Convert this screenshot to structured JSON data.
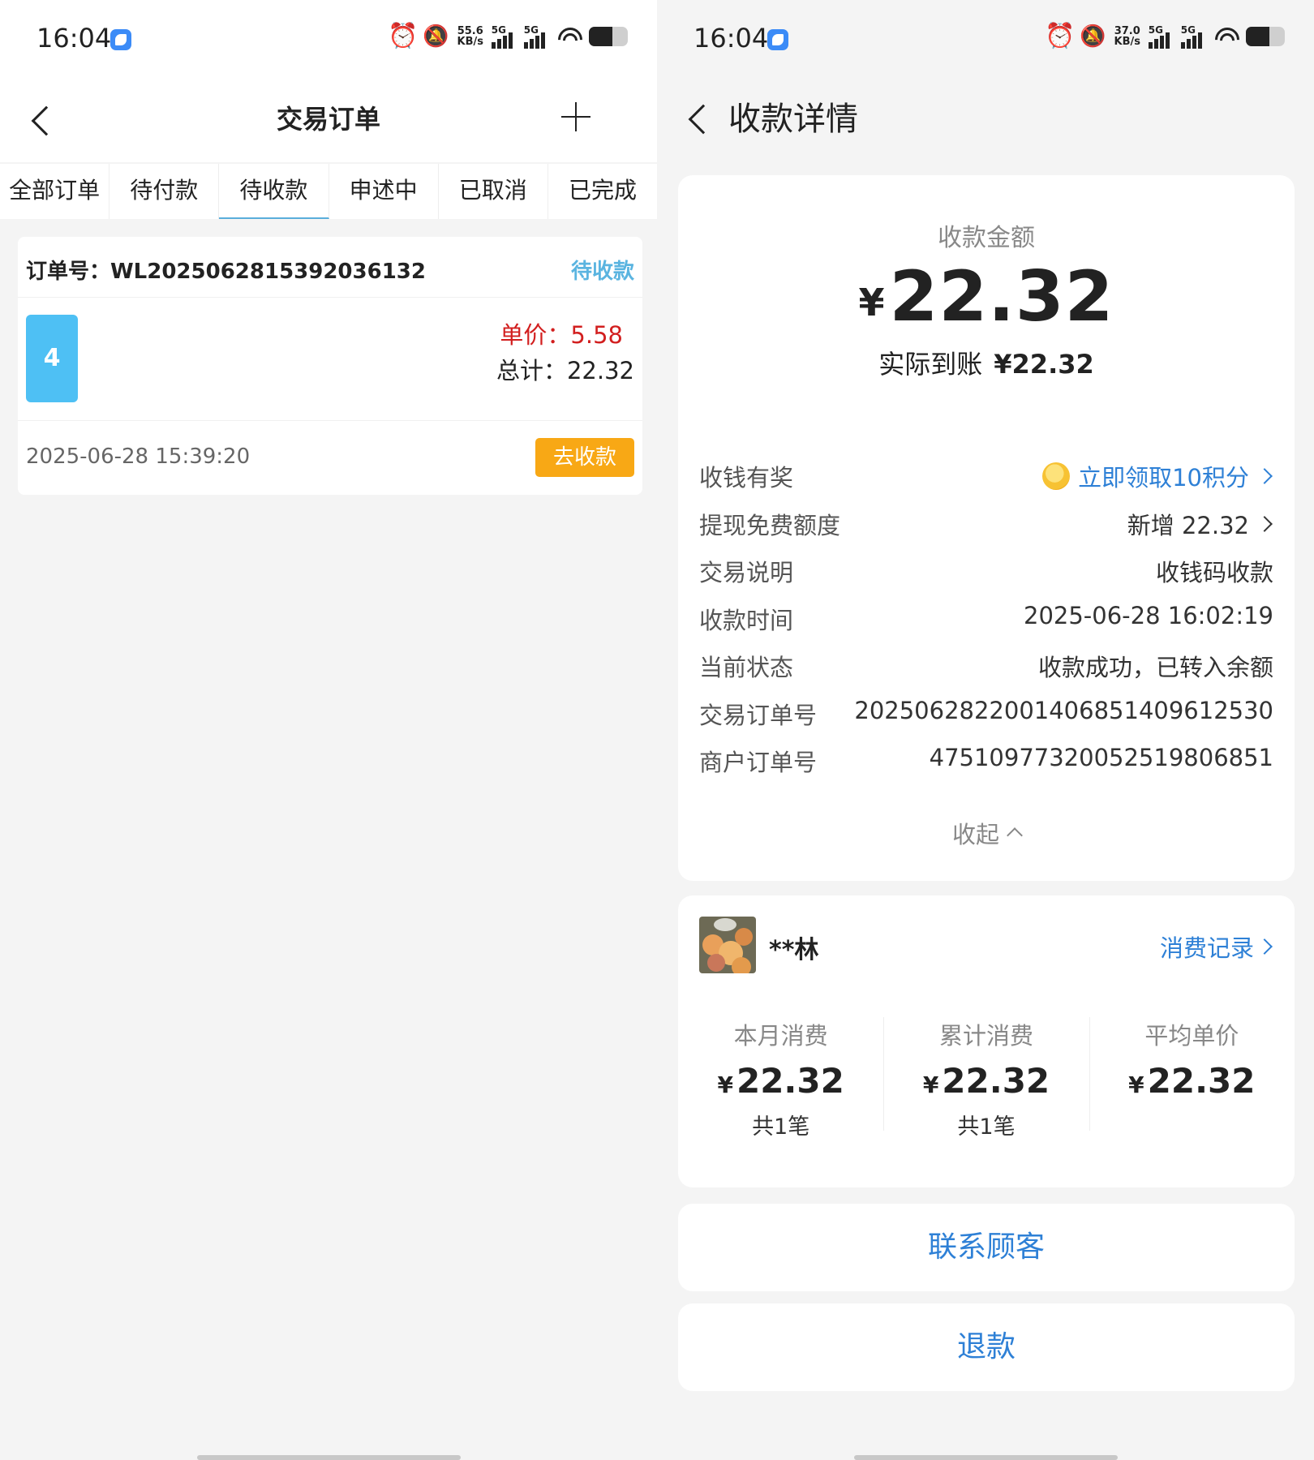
{
  "left": {
    "status_bar": {
      "time": "16:04",
      "net_speed_value": "55.6",
      "net_speed_unit": "KB/s",
      "signal1": "5G",
      "signal2": "5G",
      "battery_level": 0.6
    },
    "header": {
      "title": "交易订单"
    },
    "tabs": [
      {
        "label": "全部订单"
      },
      {
        "label": "待付款"
      },
      {
        "label": "待收款"
      },
      {
        "label": "申述中"
      },
      {
        "label": "已取消"
      },
      {
        "label": "已完成"
      }
    ],
    "active_tab_index": 2,
    "order": {
      "order_no": "订单号：WL2025062815392036132",
      "status": "待收款",
      "quantity": "4",
      "unit_price": "单价：5.58",
      "total": "总计：22.32",
      "time": "2025-06-28 15:39:20",
      "action_label": "去收款"
    }
  },
  "right": {
    "status_bar": {
      "time": "16:04",
      "net_speed_value": "37.0",
      "net_speed_unit": "KB/s",
      "signal1": "5G",
      "signal2": "5G",
      "battery_level": 0.6
    },
    "header": {
      "title": "收款详情"
    },
    "amount": {
      "label": "收款金额",
      "currency": "¥",
      "value": "22.32",
      "actual_label": "实际到账",
      "actual_value": "¥22.32"
    },
    "details": [
      {
        "label": "收钱有奖",
        "value": "立即领取10积分"
      },
      {
        "label": "提现免费额度",
        "value": "新增 22.32"
      },
      {
        "label": "交易说明",
        "value": "收钱码收款"
      },
      {
        "label": "收款时间",
        "value": "2025-06-28 16:02:19"
      },
      {
        "label": "当前状态",
        "value": "收款成功，已转入余额"
      },
      {
        "label": "交易订单号",
        "value": "20250628220014068514​09612530"
      },
      {
        "label": "商户订单号",
        "value": "47510977320052519806851"
      }
    ],
    "collapse_label": "收起",
    "customer": {
      "name": "**林",
      "records_link": "消费记录",
      "stats": [
        {
          "label": "本月消费",
          "currency": "¥",
          "value": "22.32",
          "count": "共1笔"
        },
        {
          "label": "累计消费",
          "currency": "¥",
          "value": "22.32",
          "count": "共1笔"
        },
        {
          "label": "平均单价",
          "currency": "¥",
          "value": "22.32",
          "count": ""
        }
      ]
    },
    "contact_button": "联系顾客",
    "refund_button": "退款"
  },
  "colors": {
    "accent_blue": "#2e80d6",
    "tab_underline": "#5aaedb",
    "pending_status": "#5ab4e0",
    "price_red": "#d21f1f",
    "collect_button": "#f8a815",
    "qty_badge": "#4ec0f4"
  }
}
